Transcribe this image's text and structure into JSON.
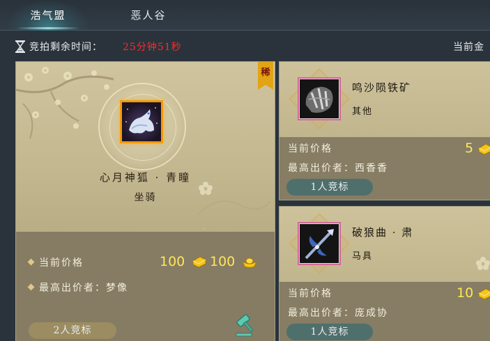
{
  "tabs": [
    {
      "label": "浩气盟",
      "active": true
    },
    {
      "label": "恶人谷",
      "active": false
    }
  ],
  "timer": {
    "label": "竞拍剩余时间：",
    "value": "25分钟51秒",
    "value_color": "#ff2a2a"
  },
  "currency": {
    "label": "当前金"
  },
  "featured": {
    "rare_tag": "稀",
    "item_icon": "white-fox-mount-icon",
    "name": "心月神狐 · 青瞳",
    "category": "坐骑",
    "price_label": "当前价格",
    "price_gold": "100",
    "price_ingot": "100",
    "top_bidder_label": "最高出价者：",
    "top_bidder": "梦像",
    "bids": "2人竞标"
  },
  "cards": [
    {
      "name": "鸣沙陨铁矿",
      "category": "其他",
      "item_icon": "meteor-iron-ore-icon",
      "price_label": "当前价格",
      "price_gold": "5",
      "top_bidder_label": "最高出价者：",
      "top_bidder": "西香香",
      "bids": "1人竞标"
    },
    {
      "name": "破狼曲 · 肃",
      "category": "马具",
      "item_icon": "blue-lance-icon",
      "price_label": "当前价格",
      "price_gold": "10",
      "top_bidder_label": "最高出价者：",
      "top_bidder": "庞成协",
      "bids": "1人竞标"
    }
  ],
  "colors": {
    "price": "#ffe65a",
    "accent_gold": "#e2a414",
    "bid_pill_teal": "#4f6f6c",
    "bid_pill_brown": "#9b8c62"
  }
}
